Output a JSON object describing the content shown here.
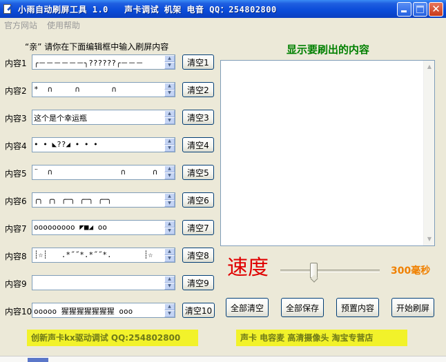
{
  "window": {
    "title": "小雨自动刷屏工具 1.0   声卡调试 机架 电音 QQ：254802800",
    "controls": [
      "minimize",
      "maximize",
      "close"
    ]
  },
  "menu": {
    "items": [
      "官方网站",
      "使用帮助"
    ]
  },
  "left": {
    "hint": "“亲” 请你在下面编辑框中输入刷屏内容",
    "rows": [
      {
        "label": "内容1",
        "value": "╭－－－－－－╮??????╭－－－",
        "clear": "清空1"
      },
      {
        "label": "内容2",
        "value": "*  ∩     ∩       ∩",
        "clear": "清空2"
      },
      {
        "label": "内容3",
        "value": "这个是个幸运瓶",
        "clear": "清空3"
      },
      {
        "label": "内容4",
        "value": "• • ◣??◢ • • •",
        "clear": "清空4"
      },
      {
        "label": "内容5",
        "value": "¨  ∩               ∩      ∩",
        "clear": "清空5"
      },
      {
        "label": "内容6",
        "value": "╭╮ ╭╮ ╭─╮ ╭─╮ ╭─╮",
        "clear": "清空6"
      },
      {
        "label": "内容7",
        "value": "ooooooooo ◤■◢ oo",
        "clear": "清空7"
      },
      {
        "label": "内容8",
        "value": "┊☆┊   .*˝˝*.*˝˝*.       ┊☆",
        "clear": "清空8"
      },
      {
        "label": "内容9",
        "value": "",
        "clear": "清空9"
      },
      {
        "label": "内容10",
        "value": "ooooo 猩猩猩猩猩猩猩 ooo",
        "clear": "清空10"
      }
    ]
  },
  "right": {
    "title": "显示要刷出的内容",
    "display_text": ""
  },
  "speed": {
    "label": "速度",
    "value_text": "300毫秒",
    "level_fraction": 0.3
  },
  "actions": {
    "clear_all": "全部清空",
    "save_all": "全部保存",
    "preset": "预置内容",
    "start": "开始刷屏"
  },
  "banners": {
    "left": "创新声卡kx驱动调试 QQ:254802800",
    "right": "声卡 电容麦 高清摄像头 淘宝专营店"
  },
  "colors": {
    "titlebar": "#0a4bd8",
    "right_title": "#008000",
    "speed_label": "#e00000",
    "speed_value": "#f08000",
    "banner_bg": "#f2f22a",
    "banner_text": "#6f7a18"
  }
}
